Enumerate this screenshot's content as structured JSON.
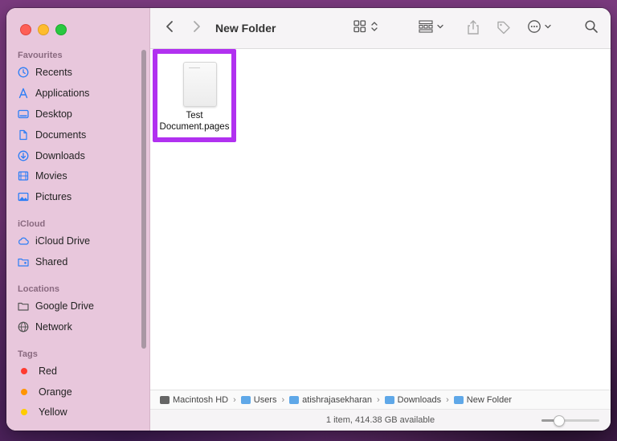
{
  "window": {
    "title": "New Folder"
  },
  "sidebar": {
    "sections": {
      "favourites": "Favourites",
      "icloud": "iCloud",
      "locations": "Locations",
      "tags": "Tags"
    },
    "favourites": [
      {
        "label": "Recents",
        "icon": "clock-icon"
      },
      {
        "label": "Applications",
        "icon": "applications-icon"
      },
      {
        "label": "Desktop",
        "icon": "desktop-icon"
      },
      {
        "label": "Documents",
        "icon": "document-icon"
      },
      {
        "label": "Downloads",
        "icon": "download-icon"
      },
      {
        "label": "Movies",
        "icon": "film-icon"
      },
      {
        "label": "Pictures",
        "icon": "photo-icon"
      }
    ],
    "icloud": [
      {
        "label": "iCloud Drive",
        "icon": "cloud-icon"
      },
      {
        "label": "Shared",
        "icon": "shared-folder-icon"
      }
    ],
    "locations": [
      {
        "label": "Google Drive",
        "icon": "drive-icon"
      },
      {
        "label": "Network",
        "icon": "globe-icon"
      }
    ],
    "tags": [
      {
        "label": "Red",
        "color": "#ff3b30"
      },
      {
        "label": "Orange",
        "color": "#ff9500"
      },
      {
        "label": "Yellow",
        "color": "#ffcc00"
      }
    ]
  },
  "toolbar": {
    "icons": [
      "back-icon",
      "forward-icon",
      "icon-view-icon",
      "group-icon",
      "share-icon",
      "tag-icon",
      "more-icon",
      "search-icon"
    ]
  },
  "files": [
    {
      "name_line1": "Test",
      "name_line2": "Document.pages"
    }
  ],
  "pathbar": [
    {
      "label": "Macintosh HD"
    },
    {
      "label": "Users"
    },
    {
      "label": "atishrajasekharan"
    },
    {
      "label": "Downloads"
    },
    {
      "label": "New Folder"
    }
  ],
  "status": {
    "text": "1 item, 414.38 GB available",
    "zoom_fraction": 0.25
  },
  "colors": {
    "sidebar_bg": "#e8c7dc",
    "accent": "#2c7ef6",
    "highlight_border": "#b131f0"
  }
}
